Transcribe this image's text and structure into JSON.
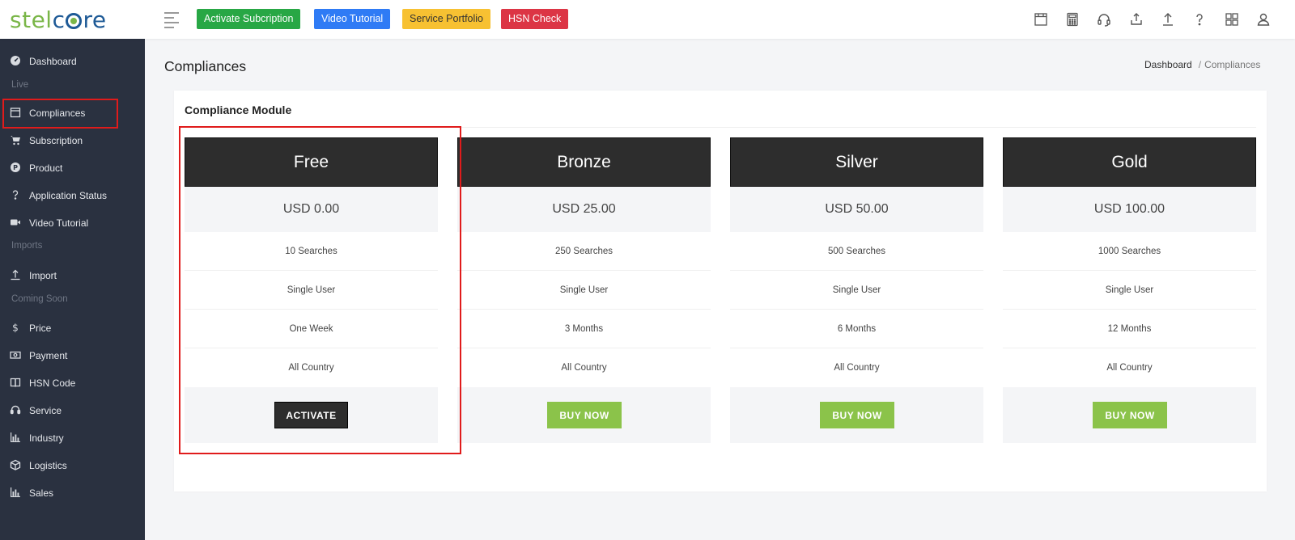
{
  "brand": {
    "part1": "stel",
    "part2": "c",
    "part3": "re"
  },
  "topbar": {
    "buttons": [
      "Activate Subcription",
      "Video Tutorial",
      "Service Portfolio",
      "HSN Check"
    ],
    "icons": [
      "notebook-icon",
      "calculator-icon",
      "headset-icon",
      "share-icon",
      "upload-icon",
      "help-icon",
      "apps-grid-icon",
      "user-icon"
    ]
  },
  "sidebar": {
    "items": [
      {
        "label": "Dashboard",
        "icon": "dashboard-icon"
      },
      {
        "label": "Compliances",
        "icon": "calendar-icon"
      },
      {
        "label": "Subscription",
        "icon": "cart-icon"
      },
      {
        "label": "Product",
        "icon": "product-icon"
      },
      {
        "label": "Application Status",
        "icon": "question-icon"
      },
      {
        "label": "Video Tutorial",
        "icon": "video-icon"
      },
      {
        "label": "Import",
        "icon": "upload-icon"
      },
      {
        "label": "Price",
        "icon": "dollar-icon"
      },
      {
        "label": "Payment",
        "icon": "payment-icon"
      },
      {
        "label": "HSN Code",
        "icon": "book-icon"
      },
      {
        "label": "Service",
        "icon": "headset-icon"
      },
      {
        "label": "Industry",
        "icon": "bar-chart-icon"
      },
      {
        "label": "Logistics",
        "icon": "box-icon"
      },
      {
        "label": "Sales",
        "icon": "bar-chart-icon"
      }
    ],
    "sections": [
      "Live",
      "Imports",
      "Coming Soon"
    ]
  },
  "page": {
    "title": "Compliances",
    "breadcrumb": [
      "Dashboard",
      "Compliances"
    ],
    "breadcrumb_sep": "/"
  },
  "module": {
    "title": "Compliance Module",
    "plans": [
      {
        "name": "Free",
        "price": "USD 0.00",
        "features": [
          "10 Searches",
          "Single User",
          "One Week",
          "All Country"
        ],
        "button": "ACTIVATE"
      },
      {
        "name": "Bronze",
        "price": "USD 25.00",
        "features": [
          "250 Searches",
          "Single User",
          "3 Months",
          "All Country"
        ],
        "button": "BUY NOW"
      },
      {
        "name": "Silver",
        "price": "USD 50.00",
        "features": [
          "500 Searches",
          "Single User",
          "6 Months",
          "All Country"
        ],
        "button": "BUY NOW"
      },
      {
        "name": "Gold",
        "price": "USD 100.00",
        "features": [
          "1000 Searches",
          "Single User",
          "12 Months",
          "All Country"
        ],
        "button": "BUY NOW"
      }
    ]
  },
  "colors": {
    "sidebar_bg": "#2a3140",
    "plan_header": "#2d2d2d",
    "buy_button": "#8bc34a",
    "highlight": "#e01b1b"
  }
}
